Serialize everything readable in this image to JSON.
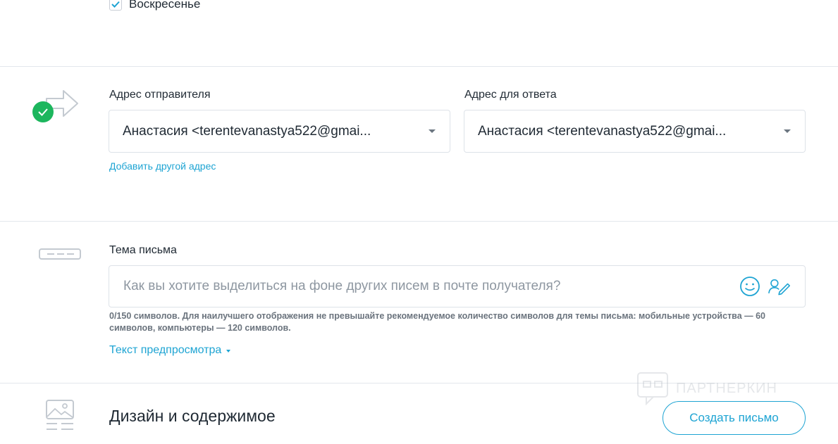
{
  "weekday": {
    "label": "Воскресенье",
    "checked": true
  },
  "sender": {
    "from_label": "Адрес отправителя",
    "from_value": "Анастасия <terentevanastya522@gmai...",
    "reply_label": "Адрес для ответа",
    "reply_value": "Анастасия <terentevanastya522@gmai...",
    "add_address": "Добавить другой адрес",
    "status": "complete"
  },
  "subject": {
    "label": "Тема письма",
    "value": "",
    "placeholder": "Как вы хотите выделиться на фоне других писем в почте получателя?",
    "hint": "0/150 символов. Для наилучшего отображения не превышайте рекомендуемое количество символов для темы письма: мобильные устройства — 60 символов, компьютеры — 120 символов.",
    "preview_text": "Текст предпросмотра"
  },
  "design": {
    "title": "Дизайн и содержимое",
    "create_button": "Создать письмо"
  },
  "watermark": {
    "text": "ПАРТНЕРКИН"
  },
  "colors": {
    "accent": "#1ea4d3",
    "success": "#1cb65d",
    "border": "#dde2e8"
  }
}
